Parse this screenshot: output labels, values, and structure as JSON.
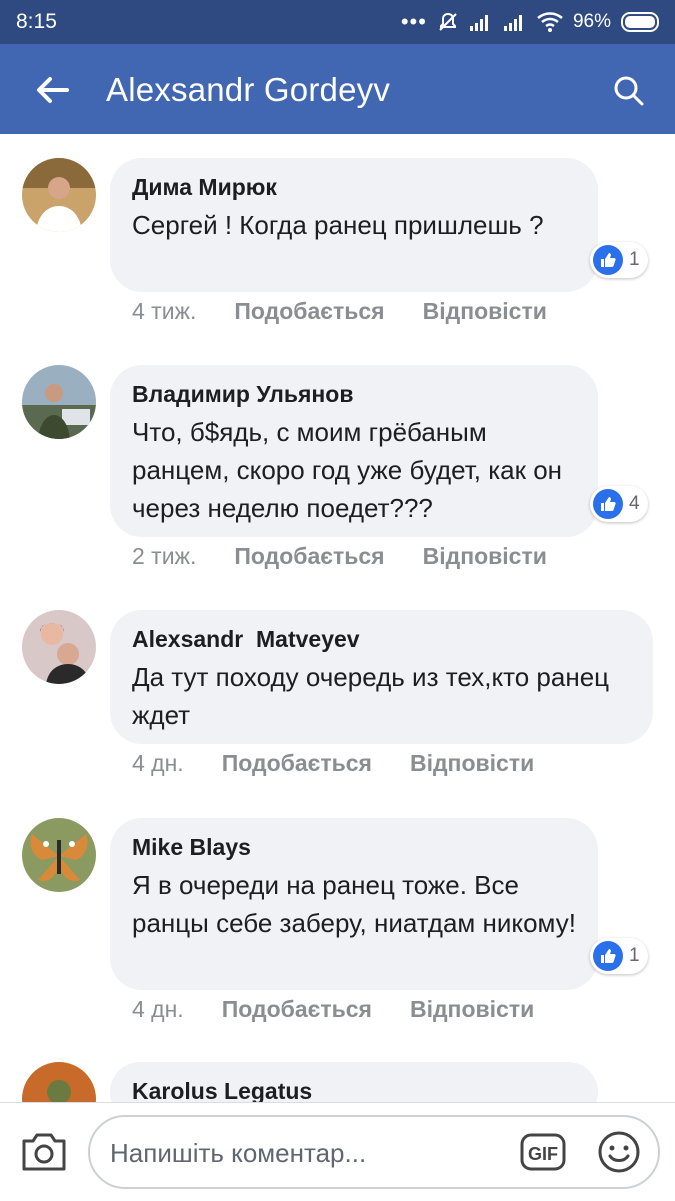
{
  "status_bar": {
    "time": "8:15",
    "battery": "96%",
    "icons": [
      "more-dots-icon",
      "mute-icon",
      "signal-icon",
      "signal-icon",
      "wifi-icon",
      "battery-icon"
    ]
  },
  "app_bar": {
    "title": "Alexsandr Gordeyv",
    "back_icon": "back-arrow-icon",
    "search_icon": "search-icon"
  },
  "comments": [
    {
      "author": "Дима Мирюк",
      "text": "Сергей ! Когда ранец пришлешь ?",
      "reactions": "1",
      "time": "4 тиж.",
      "like_label": "Подобається",
      "reply_label": "Відповісти"
    },
    {
      "author": "Владимир Ульянов",
      "text": "Что, б$ядь, с моим грёбаным ранцем, скоро год уже будет, как он через неделю поедет???",
      "reactions": "4",
      "time": "2 тиж.",
      "like_label": "Подобається",
      "reply_label": "Відповісти"
    },
    {
      "author": "Alexsandr  Matveyev",
      "text": "Да тут походу очередь из тех,кто ранец ждет",
      "reactions": "",
      "time": "4 дн.",
      "like_label": "Подобається",
      "reply_label": "Відповісти"
    },
    {
      "author": "Mike Blays",
      "text": "Я в очереди на ранец тоже. Все ранцы себе заберу, ниатдам никому!",
      "reactions": "1",
      "time": "4 дн.",
      "like_label": "Подобається",
      "reply_label": "Відповісти"
    },
    {
      "author": "Karolus Legatus",
      "text": "",
      "reactions": "",
      "time": "",
      "like_label": "",
      "reply_label": ""
    }
  ],
  "composer": {
    "placeholder": "Напишіть коментар...",
    "camera_icon": "camera-icon",
    "gif_label": "GIF",
    "emoji_icon": "smiley-icon"
  },
  "colors": {
    "status_bar": "#2f4a80",
    "app_bar": "#4267b2",
    "bubble": "#f0f2f5",
    "like_badge": "#2a70ea",
    "meta_text": "#8a8d91"
  }
}
